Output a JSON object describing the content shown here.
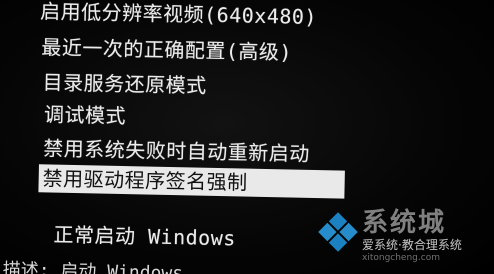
{
  "boot_menu": {
    "items": [
      {
        "label": "启用低分辨率视频(640x480)",
        "selected": false
      },
      {
        "label": "最近一次的正确配置(高级)",
        "selected": false
      },
      {
        "label": "目录服务还原模式",
        "selected": false
      },
      {
        "label": "调试模式",
        "selected": false
      },
      {
        "label": "禁用系统失败时自动重新启动",
        "selected": false
      },
      {
        "label": "禁用驱动程序签名强制",
        "selected": true
      },
      {
        "label": "正常启动 Windows",
        "selected": false
      }
    ],
    "footer_description": "描述: 启动 Windows"
  },
  "watermark": {
    "brand": "系统城",
    "subtitle": "爱系统·教合理系统",
    "url": "xitongcheng.com",
    "logo_icon": "windows-logo-icon",
    "logo_colors": [
      "#1e8fd6",
      "#1e8fd6",
      "#1e8fd6",
      "#1e8fd6"
    ]
  }
}
